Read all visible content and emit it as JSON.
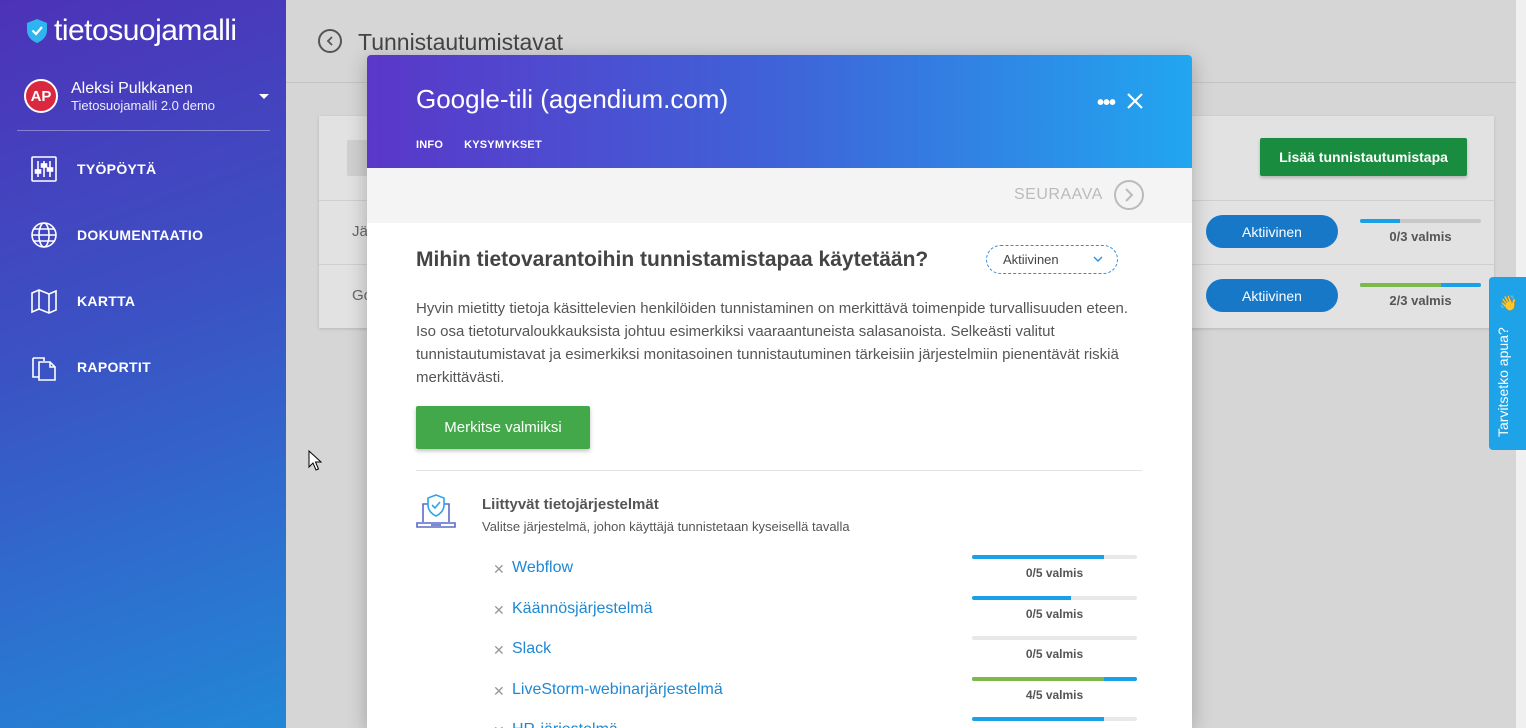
{
  "app": {
    "logo_text": "tietosuojamalli"
  },
  "user": {
    "initials": "AP",
    "name": "Aleksi Pulkkanen",
    "org": "Tietosuojamalli 2.0 demo"
  },
  "nav": [
    {
      "label": "TYÖPÖYTÄ",
      "icon": "sliders-icon"
    },
    {
      "label": "DOKUMENTAATIO",
      "icon": "globe-icon"
    },
    {
      "label": "KARTTA",
      "icon": "map-icon"
    },
    {
      "label": "RAPORTIT",
      "icon": "documents-icon"
    }
  ],
  "page": {
    "title": "Tunnistautumistavat",
    "add_button": "Lisää tunnistautumistapa",
    "rows": [
      {
        "label": "Jär",
        "status": "Aktiivinen",
        "progress_label": "0/3 valmis",
        "progress": 0.33
      },
      {
        "label": "Go",
        "status": "Aktiivinen",
        "progress_label": "2/3 valmis",
        "progress": 1.0,
        "progress_split": 0.67
      }
    ]
  },
  "help": {
    "label": "Tarvitsetko apua?",
    "emoji": "👋"
  },
  "modal": {
    "title": "Google-tili (agendium.com)",
    "tabs": [
      "INFO",
      "KYSYMYKSET"
    ],
    "next_label": "SEURAAVA",
    "question": "Mihin tietovarantoihin tunnistamistapaa käytetään?",
    "status_value": "Aktiivinen",
    "description": "Hyvin mietitty tietoja käsittelevien henkilöiden tunnistaminen on merkittävä toimenpide turvallisuuden eteen. Iso osa tietoturvaloukkauksista johtuu esimerkiksi vaaraantuneista salasanoista. Selkeästi valitut tunnistautumistavat ja esimerkiksi monitasoinen tunnistautuminen tärkeisiin järjestelmiin pienentävät riskiä merkittävästi.",
    "done_button": "Merkitse valmiiksi",
    "systems_title": "Liittyvät tietojärjestelmät",
    "systems_subtitle": "Valitse järjestelmä, johon käyttäjä tunnistetaan kyseisellä tavalla",
    "systems": [
      {
        "name": "Webflow",
        "progress_label": "0/5 valmis",
        "progress": 0.8,
        "green": 0
      },
      {
        "name": "Käännösjärjestelmä",
        "progress_label": "0/5 valmis",
        "progress": 0.6,
        "green": 0
      },
      {
        "name": "Slack",
        "progress_label": "0/5 valmis",
        "progress": 0,
        "green": 0
      },
      {
        "name": "LiveStorm-webinarjärjestelmä",
        "progress_label": "4/5 valmis",
        "progress": 1.0,
        "green": 0.8
      },
      {
        "name": "HR-järjestelmä",
        "progress_label": "",
        "progress": 0.8,
        "green": 0
      }
    ]
  },
  "colors": {
    "accent_blue": "#1e88d2",
    "bar_blue": "#1aa0e6",
    "bar_green": "#7cb84a",
    "button_green": "#43a849"
  }
}
